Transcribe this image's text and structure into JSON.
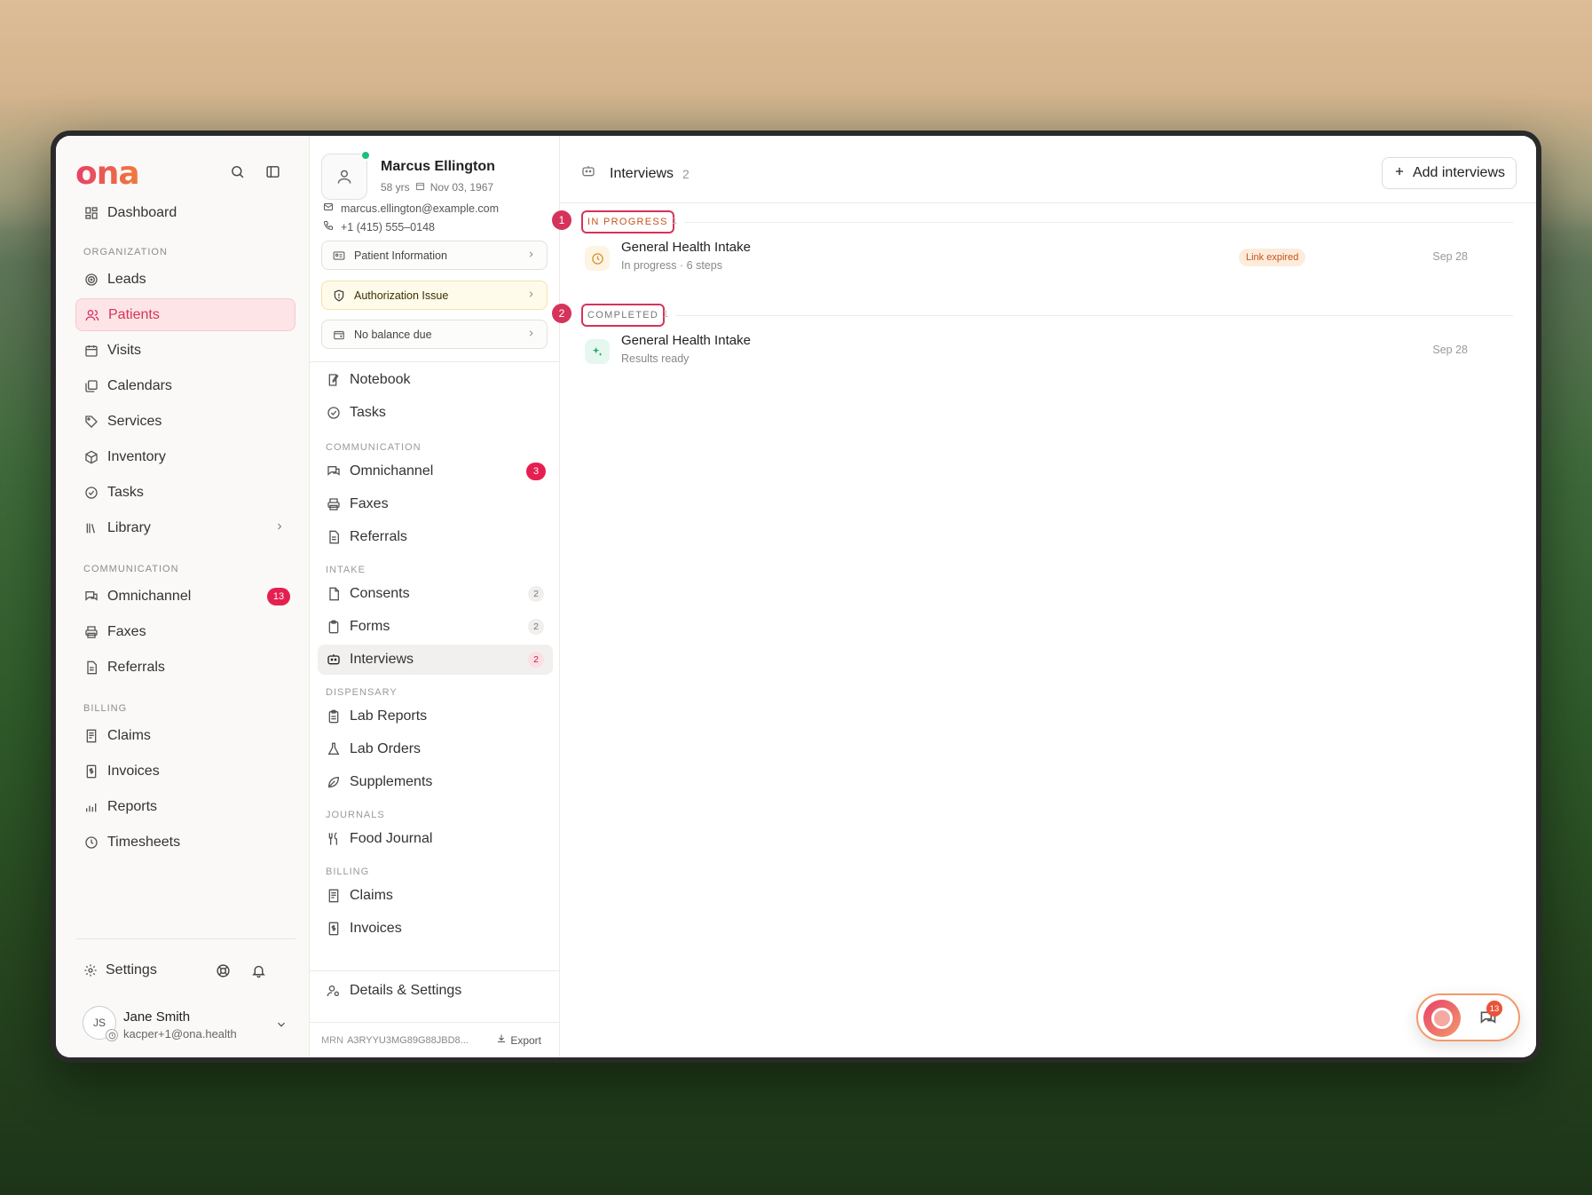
{
  "brand": {
    "logo_text": "ona"
  },
  "sidebar": {
    "top_items": [
      {
        "label": "Dashboard",
        "icon": "dashboard-icon"
      }
    ],
    "sections": [
      {
        "title": "ORGANIZATION",
        "items": [
          {
            "label": "Leads",
            "icon": "target-icon"
          },
          {
            "label": "Patients",
            "icon": "users-icon",
            "active": true
          },
          {
            "label": "Visits",
            "icon": "calendar-grid-icon"
          },
          {
            "label": "Calendars",
            "icon": "calendars-icon"
          },
          {
            "label": "Services",
            "icon": "tag-icon"
          },
          {
            "label": "Inventory",
            "icon": "box-icon"
          },
          {
            "label": "Tasks",
            "icon": "check-circle-icon"
          },
          {
            "label": "Library",
            "icon": "library-icon"
          }
        ]
      },
      {
        "title": "COMMUNICATION",
        "items": [
          {
            "label": "Omnichannel",
            "icon": "chat-icon",
            "badge": "13"
          },
          {
            "label": "Faxes",
            "icon": "printer-icon"
          },
          {
            "label": "Referrals",
            "icon": "document-icon"
          }
        ]
      },
      {
        "title": "BILLING",
        "items": [
          {
            "label": "Claims",
            "icon": "receipt-icon"
          },
          {
            "label": "Invoices",
            "icon": "invoice-icon"
          },
          {
            "label": "Reports",
            "icon": "chart-icon"
          },
          {
            "label": "Timesheets",
            "icon": "clock-icon"
          }
        ]
      }
    ],
    "settings_label": "Settings",
    "user": {
      "initials": "JS",
      "name": "Jane Smith",
      "email": "kacper+1@ona.health"
    }
  },
  "patient": {
    "name": "Marcus Ellington",
    "age": "58 yrs",
    "dob": "Nov 03, 1967",
    "email": "marcus.ellington@example.com",
    "phone": "+1 (415) 555–0148",
    "cards": {
      "info": "Patient Information",
      "auth": "Authorization Issue",
      "balance": "No balance due"
    },
    "mrn_label": "MRN",
    "mrn": "A3RYYU3MG89G88JBD8...",
    "export_label": "Export"
  },
  "patient_nav": {
    "top": [
      {
        "label": "Notebook",
        "icon": "notebook-icon"
      },
      {
        "label": "Tasks",
        "icon": "check-circle-icon"
      }
    ],
    "communication_title": "COMMUNICATION",
    "communication": [
      {
        "label": "Omnichannel",
        "icon": "chat-icon",
        "badge": "3"
      },
      {
        "label": "Faxes",
        "icon": "printer-icon"
      },
      {
        "label": "Referrals",
        "icon": "document-icon"
      }
    ],
    "intake_title": "INTAKE",
    "intake": [
      {
        "label": "Consents",
        "icon": "consent-icon",
        "count": "2"
      },
      {
        "label": "Forms",
        "icon": "clipboard-icon",
        "count": "2"
      },
      {
        "label": "Interviews",
        "icon": "bot-icon",
        "count": "2",
        "active": true
      }
    ],
    "dispensary_title": "DISPENSARY",
    "dispensary": [
      {
        "label": "Lab Reports",
        "icon": "clipboard-icon"
      },
      {
        "label": "Lab Orders",
        "icon": "flask-icon"
      },
      {
        "label": "Supplements",
        "icon": "leaf-icon"
      }
    ],
    "journals_title": "JOURNALS",
    "journals": [
      {
        "label": "Food Journal",
        "icon": "utensils-icon"
      }
    ],
    "billing_title": "BILLING",
    "billing": [
      {
        "label": "Claims",
        "icon": "receipt-icon"
      },
      {
        "label": "Invoices",
        "icon": "invoice-icon"
      }
    ],
    "details_label": "Details & Settings"
  },
  "main": {
    "title": "Interviews",
    "count": "2",
    "add_button": "Add interviews",
    "groups": [
      {
        "step": "1",
        "label": "IN PROGRESS",
        "count": "1",
        "color": "#c7531b",
        "items": [
          {
            "title": "General Health Intake",
            "subtitle": "In progress · 6 steps",
            "badge": "Link expired",
            "date": "Sep 28"
          }
        ]
      },
      {
        "step": "2",
        "label": "COMPLETED",
        "count": "1",
        "color": "#777777",
        "items": [
          {
            "title": "General Health Intake",
            "subtitle": "Results ready",
            "date": "Sep 28"
          }
        ]
      }
    ]
  },
  "chat_widget": {
    "badge": "13"
  },
  "colors": {
    "accent": "#d6335a",
    "badge_red": "#e51f4f",
    "online": "#1fbf7e"
  }
}
